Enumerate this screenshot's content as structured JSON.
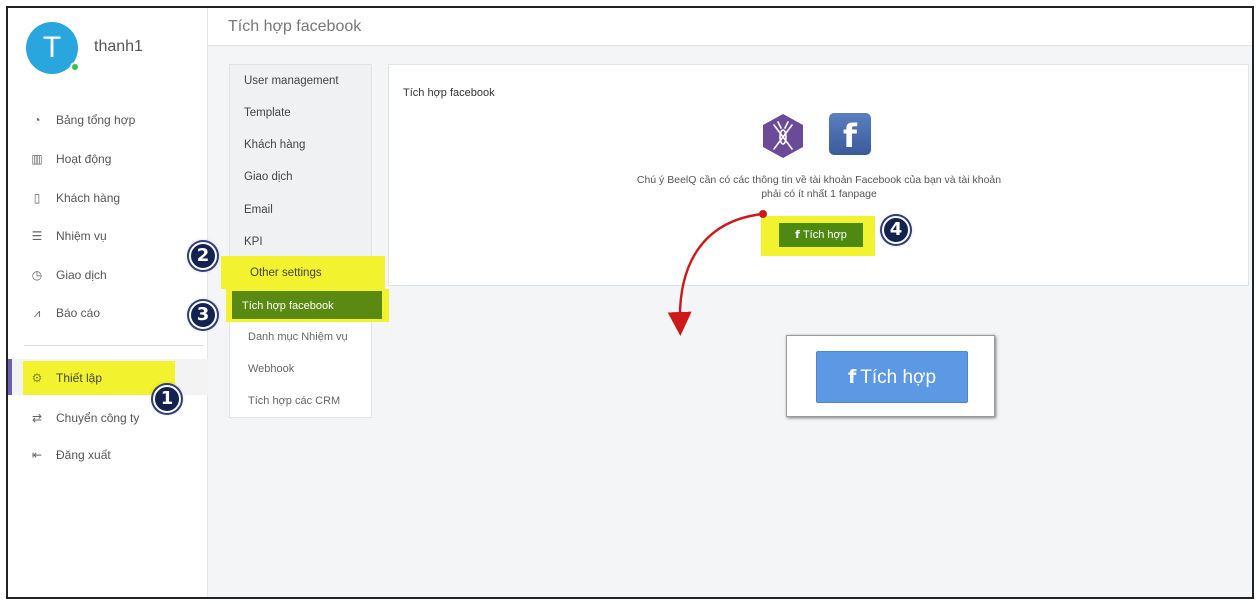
{
  "user": {
    "avatar_letter": "T",
    "name": "thanh1"
  },
  "sidebar": {
    "items": [
      {
        "label": "Bảng tổng hợp",
        "icon": "dashboard-icon",
        "glyph": "◔"
      },
      {
        "label": "Hoạt động",
        "icon": "activity-icon",
        "glyph": "▥"
      },
      {
        "label": "Khách hàng",
        "icon": "customer-icon",
        "glyph": "▯"
      },
      {
        "label": "Nhiệm vụ",
        "icon": "task-icon",
        "glyph": "☰"
      },
      {
        "label": "Giao dịch",
        "icon": "transaction-icon",
        "glyph": "◷"
      },
      {
        "label": "Báo cáo",
        "icon": "report-icon",
        "glyph": "⩘"
      }
    ],
    "bottom_items": [
      {
        "label": "Thiết lập",
        "icon": "gear-icon",
        "glyph": "⚙"
      },
      {
        "label": "Chuyển công ty",
        "icon": "switch-icon",
        "glyph": "⇄"
      },
      {
        "label": "Đăng xuất",
        "icon": "logout-icon",
        "glyph": "⇤"
      }
    ]
  },
  "header": {
    "title": "Tích hợp facebook"
  },
  "settings_menu": {
    "items": [
      "User management",
      "Template",
      "Khách hàng",
      "Giao dịch",
      "Email",
      "KPI",
      "Other settings"
    ],
    "sub_items": [
      "Tích hợp facebook",
      "Danh mục Nhiệm vụ",
      "Webhook",
      "Tích hợp các CRM"
    ]
  },
  "card": {
    "title": "Tích hợp facebook",
    "notice_line1": "Chú ý BeelQ cần có các thông tin về tài khoản Facebook của bạn và tài khoản",
    "notice_line2": "phải có ít nhất 1 fanpage",
    "button_glyph": "f",
    "button_label": "Tích hợp",
    "fb_logo_letter": "f"
  },
  "zoom": {
    "button_glyph": "f",
    "button_label": "Tích hợp"
  },
  "steps": [
    "1",
    "2",
    "3",
    "4"
  ],
  "colors": {
    "accent": "#5b8a12",
    "highlight": "#f2f22e",
    "avatar": "#2aa6df",
    "zoom_button": "#5d98e4",
    "arrow": "#cc1a1a"
  }
}
